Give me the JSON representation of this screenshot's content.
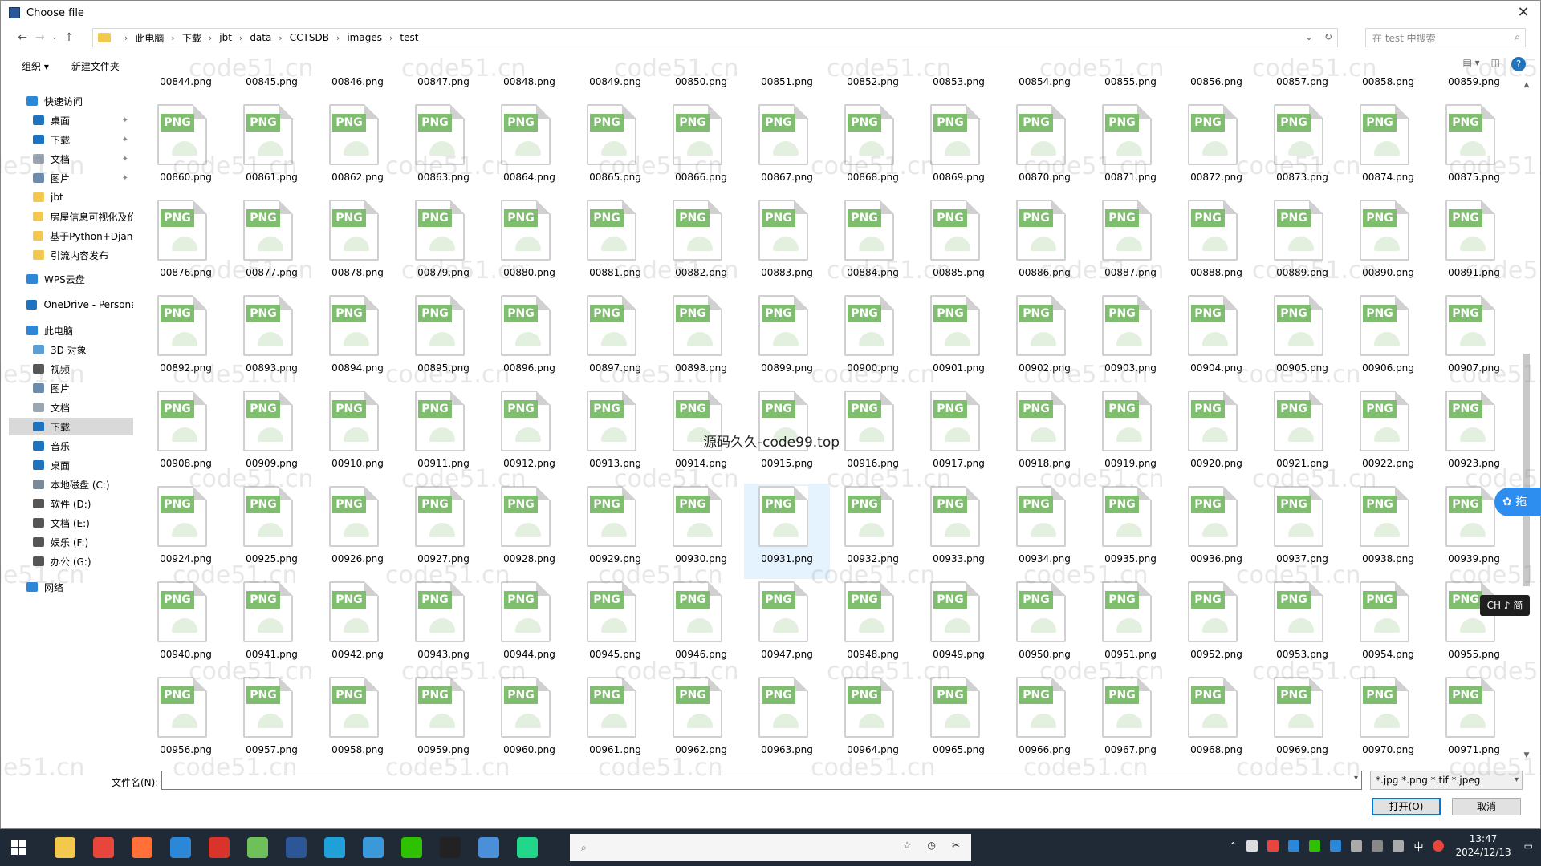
{
  "window": {
    "title": "Choose file"
  },
  "breadcrumb": [
    "此电脑",
    "下载",
    "jbt",
    "data",
    "CCTSDB",
    "images",
    "test"
  ],
  "search": {
    "placeholder": "在 test 中搜索"
  },
  "toolbar": {
    "organize": "组织 ▾",
    "new_folder": "新建文件夹"
  },
  "sidebar": [
    {
      "label": "快速访问",
      "icon": "star-icon",
      "color": "#2b88d8",
      "indent": 0
    },
    {
      "label": "桌面",
      "icon": "desktop-icon",
      "color": "#1e73be",
      "indent": 1,
      "pinned": true
    },
    {
      "label": "下载",
      "icon": "download-icon",
      "color": "#1e73be",
      "indent": 1,
      "pinned": true
    },
    {
      "label": "文档",
      "icon": "document-icon",
      "color": "#9aa6b2",
      "indent": 1,
      "pinned": true
    },
    {
      "label": "图片",
      "icon": "picture-icon",
      "color": "#6a8caf",
      "indent": 1,
      "pinned": true
    },
    {
      "label": "jbt",
      "icon": "folder-icon",
      "color": "#f2c94c",
      "indent": 1
    },
    {
      "label": "房屋信息可视化及价",
      "icon": "folder-icon",
      "color": "#f2c94c",
      "indent": 1
    },
    {
      "label": "基于Python+Djang",
      "icon": "folder-icon",
      "color": "#f2c94c",
      "indent": 1
    },
    {
      "label": "引流内容发布",
      "icon": "folder-icon",
      "color": "#f2c94c",
      "indent": 1
    },
    {
      "label": "WPS云盘",
      "icon": "cloud-icon",
      "color": "#2b88d8",
      "indent": 0
    },
    {
      "label": "OneDrive - Persona",
      "icon": "onedrive-icon",
      "color": "#1e73be",
      "indent": 0
    },
    {
      "label": "此电脑",
      "icon": "computer-icon",
      "color": "#2b88d8",
      "indent": 0
    },
    {
      "label": "3D 对象",
      "icon": "cube-icon",
      "color": "#5aa0d8",
      "indent": 1
    },
    {
      "label": "视频",
      "icon": "video-icon",
      "color": "#555555",
      "indent": 1
    },
    {
      "label": "图片",
      "icon": "picture-icon",
      "color": "#6a8caf",
      "indent": 1
    },
    {
      "label": "文档",
      "icon": "document-icon",
      "color": "#9aa6b2",
      "indent": 1
    },
    {
      "label": "下载",
      "icon": "download-icon",
      "color": "#1e73be",
      "indent": 1,
      "selected": true
    },
    {
      "label": "音乐",
      "icon": "music-icon",
      "color": "#1e73be",
      "indent": 1
    },
    {
      "label": "桌面",
      "icon": "desktop-icon",
      "color": "#1e73be",
      "indent": 1
    },
    {
      "label": "本地磁盘 (C:)",
      "icon": "drive-icon",
      "color": "#7a8a99",
      "indent": 1
    },
    {
      "label": "软件 (D:)",
      "icon": "drive-icon",
      "color": "#555555",
      "indent": 1
    },
    {
      "label": "文档 (E:)",
      "icon": "drive-icon",
      "color": "#555555",
      "indent": 1
    },
    {
      "label": "娱乐 (F:)",
      "icon": "drive-icon",
      "color": "#555555",
      "indent": 1
    },
    {
      "label": "办公 (G:)",
      "icon": "drive-icon",
      "color": "#555555",
      "indent": 1
    },
    {
      "label": "网络",
      "icon": "network-icon",
      "color": "#2b88d8",
      "indent": 0
    }
  ],
  "files": {
    "top_row_labels": [
      "00844.png",
      "00845.png",
      "00846.png",
      "00847.png",
      "00848.png",
      "00849.png",
      "00850.png",
      "00851.png",
      "00852.png",
      "00853.png",
      "00854.png",
      "00855.png",
      "00856.png",
      "00857.png",
      "00858.png",
      "00859.png"
    ],
    "rows": [
      [
        "00860.png",
        "00861.png",
        "00862.png",
        "00863.png",
        "00864.png",
        "00865.png",
        "00866.png",
        "00867.png",
        "00868.png",
        "00869.png",
        "00870.png",
        "00871.png",
        "00872.png",
        "00873.png",
        "00874.png",
        "00875.png"
      ],
      [
        "00876.png",
        "00877.png",
        "00878.png",
        "00879.png",
        "00880.png",
        "00881.png",
        "00882.png",
        "00883.png",
        "00884.png",
        "00885.png",
        "00886.png",
        "00887.png",
        "00888.png",
        "00889.png",
        "00890.png",
        "00891.png"
      ],
      [
        "00892.png",
        "00893.png",
        "00894.png",
        "00895.png",
        "00896.png",
        "00897.png",
        "00898.png",
        "00899.png",
        "00900.png",
        "00901.png",
        "00902.png",
        "00903.png",
        "00904.png",
        "00905.png",
        "00906.png",
        "00907.png"
      ],
      [
        "00908.png",
        "00909.png",
        "00910.png",
        "00911.png",
        "00912.png",
        "00913.png",
        "00914.png",
        "00915.png",
        "00916.png",
        "00917.png",
        "00918.png",
        "00919.png",
        "00920.png",
        "00921.png",
        "00922.png",
        "00923.png"
      ],
      [
        "00924.png",
        "00925.png",
        "00926.png",
        "00927.png",
        "00928.png",
        "00929.png",
        "00930.png",
        "00931.png",
        "00932.png",
        "00933.png",
        "00934.png",
        "00935.png",
        "00936.png",
        "00937.png",
        "00938.png",
        "00939.png"
      ],
      [
        "00940.png",
        "00941.png",
        "00942.png",
        "00943.png",
        "00944.png",
        "00945.png",
        "00946.png",
        "00947.png",
        "00948.png",
        "00949.png",
        "00950.png",
        "00951.png",
        "00952.png",
        "00953.png",
        "00954.png",
        "00955.png"
      ],
      [
        "00956.png",
        "00957.png",
        "00958.png",
        "00959.png",
        "00960.png",
        "00961.png",
        "00962.png",
        "00963.png",
        "00964.png",
        "00965.png",
        "00966.png",
        "00967.png",
        "00968.png",
        "00969.png",
        "00970.png",
        "00971.png"
      ]
    ],
    "badge": "PNG",
    "hovered": "00931.png"
  },
  "bottom": {
    "filename_label": "文件名(N):",
    "filename_value": "",
    "filter": "*.jpg *.png *.tif *.jpeg",
    "open_button": "打开(O)",
    "cancel_button": "取消"
  },
  "overlay": {
    "watermark": "code51.cn",
    "center_text": "源码久久-code99.top",
    "float_label": "拖",
    "ime": "CH ♪ 简"
  },
  "taskbar": {
    "time": "13:47",
    "date": "2024/12/13",
    "lang": "中",
    "apps": [
      {
        "name": "file-explorer-icon",
        "color": "#f2c94c"
      },
      {
        "name": "chrome-icon",
        "color": "#e8453c"
      },
      {
        "name": "firefox-icon",
        "color": "#ff7139"
      },
      {
        "name": "vscode-icon",
        "color": "#2b88d8"
      },
      {
        "name": "wps-icon",
        "color": "#d9342b"
      },
      {
        "name": "notepad-icon",
        "color": "#6fbf5a"
      },
      {
        "name": "word-icon",
        "color": "#2b5797"
      },
      {
        "name": "edge-icon",
        "color": "#1fa0d8"
      },
      {
        "name": "paint-icon",
        "color": "#3a9ad9"
      },
      {
        "name": "wechat-icon",
        "color": "#2dc100"
      },
      {
        "name": "qq-icon",
        "color": "#222222"
      },
      {
        "name": "screenshot-icon",
        "color": "#4a90d9"
      },
      {
        "name": "pycharm-icon",
        "color": "#21d789"
      },
      {
        "name": "excel-icon",
        "color": "#1e7145"
      }
    ]
  }
}
